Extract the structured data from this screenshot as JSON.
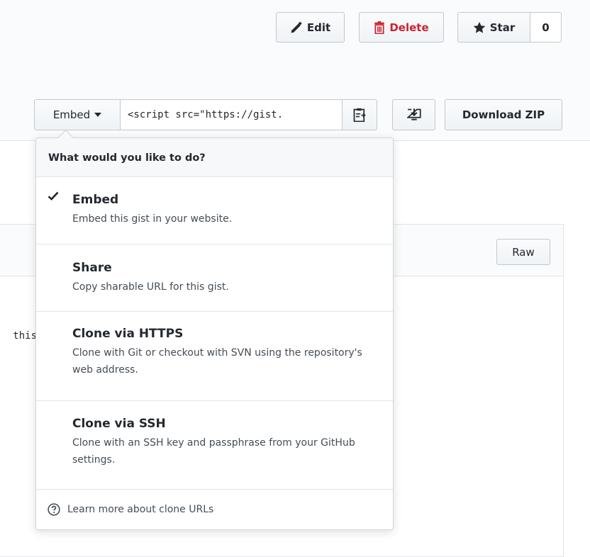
{
  "actions": {
    "edit_label": "Edit",
    "delete_label": "Delete",
    "star_label": "Star",
    "star_count": "0"
  },
  "clone_bar": {
    "embed_label": "Embed",
    "embed_value": "<script src=\"https://gist.",
    "download_label": "Download ZIP"
  },
  "file": {
    "raw_label": "Raw",
    "code_fragment": "this"
  },
  "dropdown": {
    "header": "What would you like to do?",
    "options": [
      {
        "title": "Embed",
        "desc": "Embed this gist in your website."
      },
      {
        "title": "Share",
        "desc": "Copy sharable URL for this gist."
      },
      {
        "title": "Clone via HTTPS",
        "desc": "Clone with Git or checkout with SVN using the repository's web address."
      },
      {
        "title": "Clone via SSH",
        "desc": "Clone with an SSH key and passphrase from your GitHub settings."
      }
    ],
    "footer": "Learn more about clone URLs"
  },
  "colors": {
    "delete_red": "#cb2431",
    "border": "#e1e4e8",
    "text": "#24292e"
  },
  "icons": [
    "pencil-icon",
    "trash-icon",
    "star-icon",
    "caret-down-icon",
    "clipboard-icon",
    "desktop-download-icon",
    "check-icon",
    "question-icon"
  ]
}
